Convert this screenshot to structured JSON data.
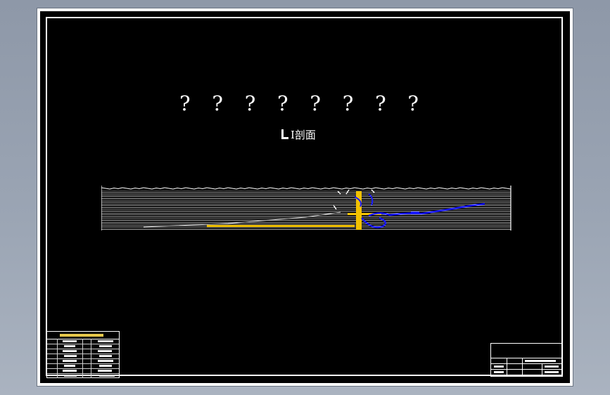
{
  "drawing": {
    "placeholder_marks": [
      "?",
      "?",
      "?",
      "?",
      "?",
      "?",
      "?",
      "?"
    ],
    "section_label": "I剖面"
  },
  "colors": {
    "background": "#000000",
    "frame": "#ffffff",
    "strata_lines": "#ffffff",
    "accent_yellow": "#f2c200",
    "accent_blue": "#1a1aff"
  },
  "icons": {
    "section_symbol": "section-cut-icon"
  }
}
